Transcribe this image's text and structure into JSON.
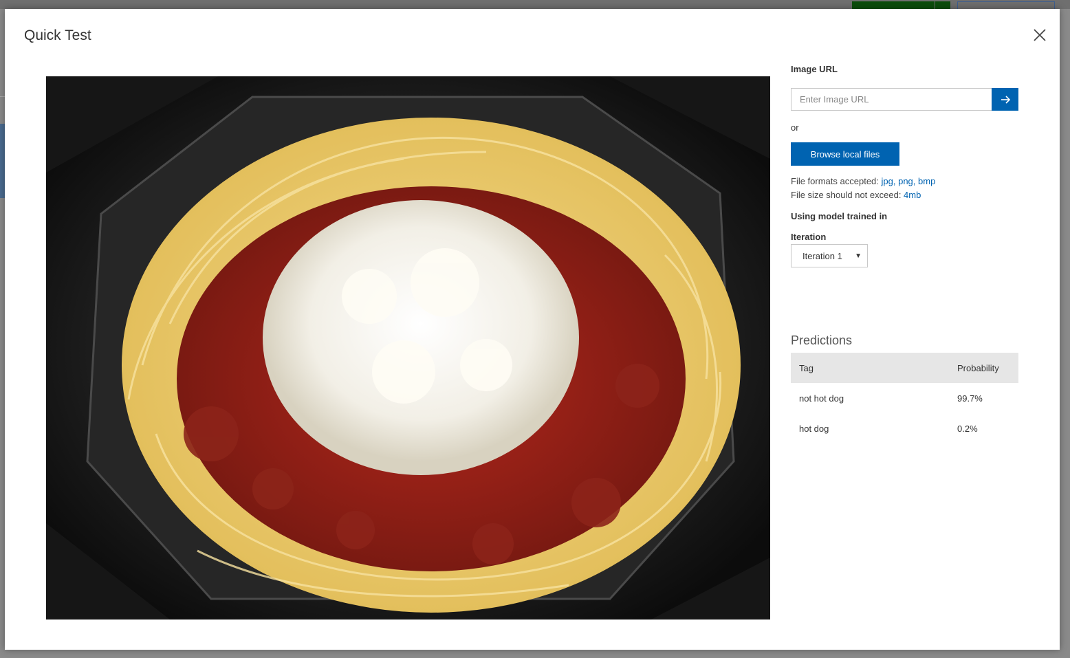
{
  "modal": {
    "title": "Quick Test"
  },
  "image_url": {
    "label": "Image URL",
    "placeholder": "Enter Image URL"
  },
  "or_text": "or",
  "browse_button": "Browse local files",
  "file_info": {
    "formats_prefix": "File formats accepted: ",
    "formats": [
      "jpg",
      "png",
      "bmp"
    ],
    "size_prefix": "File size should not exceed: ",
    "size": "4mb"
  },
  "model": {
    "trained_label": "Using model trained in",
    "iteration_label": "Iteration",
    "iteration_selected": "Iteration 1"
  },
  "predictions": {
    "title": "Predictions",
    "columns": [
      "Tag",
      "Probability"
    ],
    "rows": [
      {
        "tag": "not hot dog",
        "probability": "99.7%"
      },
      {
        "tag": "hot dog",
        "probability": "0.2%"
      }
    ]
  },
  "colors": {
    "accent": "#0063b1",
    "table_header": "#e6e6e6"
  },
  "preview_image": {
    "description_icon": "spaghetti-photo"
  }
}
